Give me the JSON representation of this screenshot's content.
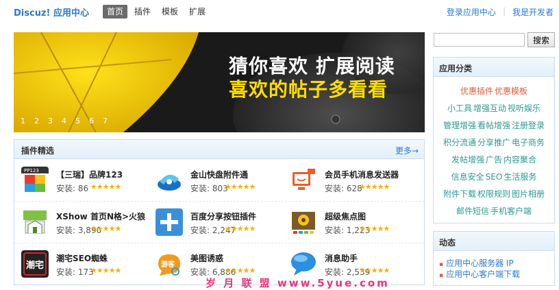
{
  "header": {
    "logo": "Discuz! 应用中心",
    "nav": [
      "首页",
      "插件",
      "模板",
      "扩展"
    ],
    "login_link": "登录应用中心",
    "dev_link": "我是开发者"
  },
  "banner": {
    "line1": "猜你喜欢  扩展阅读",
    "line2": "喜欢的帖子多看看",
    "pages": [
      "1",
      "2",
      "3",
      "4",
      "5",
      "6",
      "7"
    ]
  },
  "plugins": {
    "title": "插件精选",
    "more": "更多→",
    "items": [
      {
        "name": "【三瑞】品牌123",
        "installs": "安装: 86",
        "rating": 5,
        "icon": "pp123-app-icon"
      },
      {
        "name": "金山快盘附件通",
        "installs": "安装: 803",
        "rating": 4.5,
        "icon": "kuaipan-app-icon"
      },
      {
        "name": "会员手机消息发送器",
        "installs": "安装: 628",
        "rating": 5,
        "icon": "mobile-message-app-icon"
      },
      {
        "name": "XShow 首页N格>火狼",
        "installs": "安装: 3,890",
        "rating": 5,
        "icon": "xshow-app-icon"
      },
      {
        "name": "百度分享按钮插件",
        "installs": "安装: 2,247",
        "rating": 4.5,
        "icon": "baidu-share-app-icon"
      },
      {
        "name": "超级焦点图",
        "installs": "安装: 1,223",
        "rating": 5,
        "icon": "focus-image-app-icon"
      },
      {
        "name": "潮宅SEO蜘蛛",
        "installs": "安装: 173",
        "rating": 5,
        "icon": "chaozhai-seo-app-icon"
      },
      {
        "name": "美图诱惑",
        "installs": "安装: 6,886",
        "rating": 5,
        "icon": "meitu-app-icon"
      },
      {
        "name": "消息助手",
        "installs": "安装: 2,539",
        "rating": 5,
        "icon": "message-assistant-app-icon"
      }
    ]
  },
  "search": {
    "placeholder": "",
    "button": "搜索"
  },
  "categories": {
    "title": "应用分类",
    "lines": [
      [
        "优惠插件",
        "优惠模板"
      ],
      [
        "小工具",
        "增强互动",
        "视听娱乐"
      ],
      [
        "管理增强",
        "看帖增强",
        "注册登录"
      ],
      [
        "积分流通",
        "分享推广",
        "电子商务"
      ],
      [
        "发帖增强",
        "广告",
        "内容聚合"
      ],
      [
        "信息安全",
        "SEO",
        "生活服务"
      ],
      [
        "附件下载",
        "权限规则",
        "图片相册"
      ],
      [
        "邮件短信",
        "手机客户端"
      ]
    ]
  },
  "dynamics": {
    "title": "动态",
    "items": [
      "应用中心服务器 IP",
      "应用中心客户端下载"
    ]
  },
  "watermark": "岁 月 联 盟  www.5yue.com",
  "colors": {
    "link": "#2b7acd",
    "category": "#2b9a8e",
    "hot": "#e05a3c",
    "star": "#f2b100",
    "banner_highlight": "#ffdd00"
  }
}
